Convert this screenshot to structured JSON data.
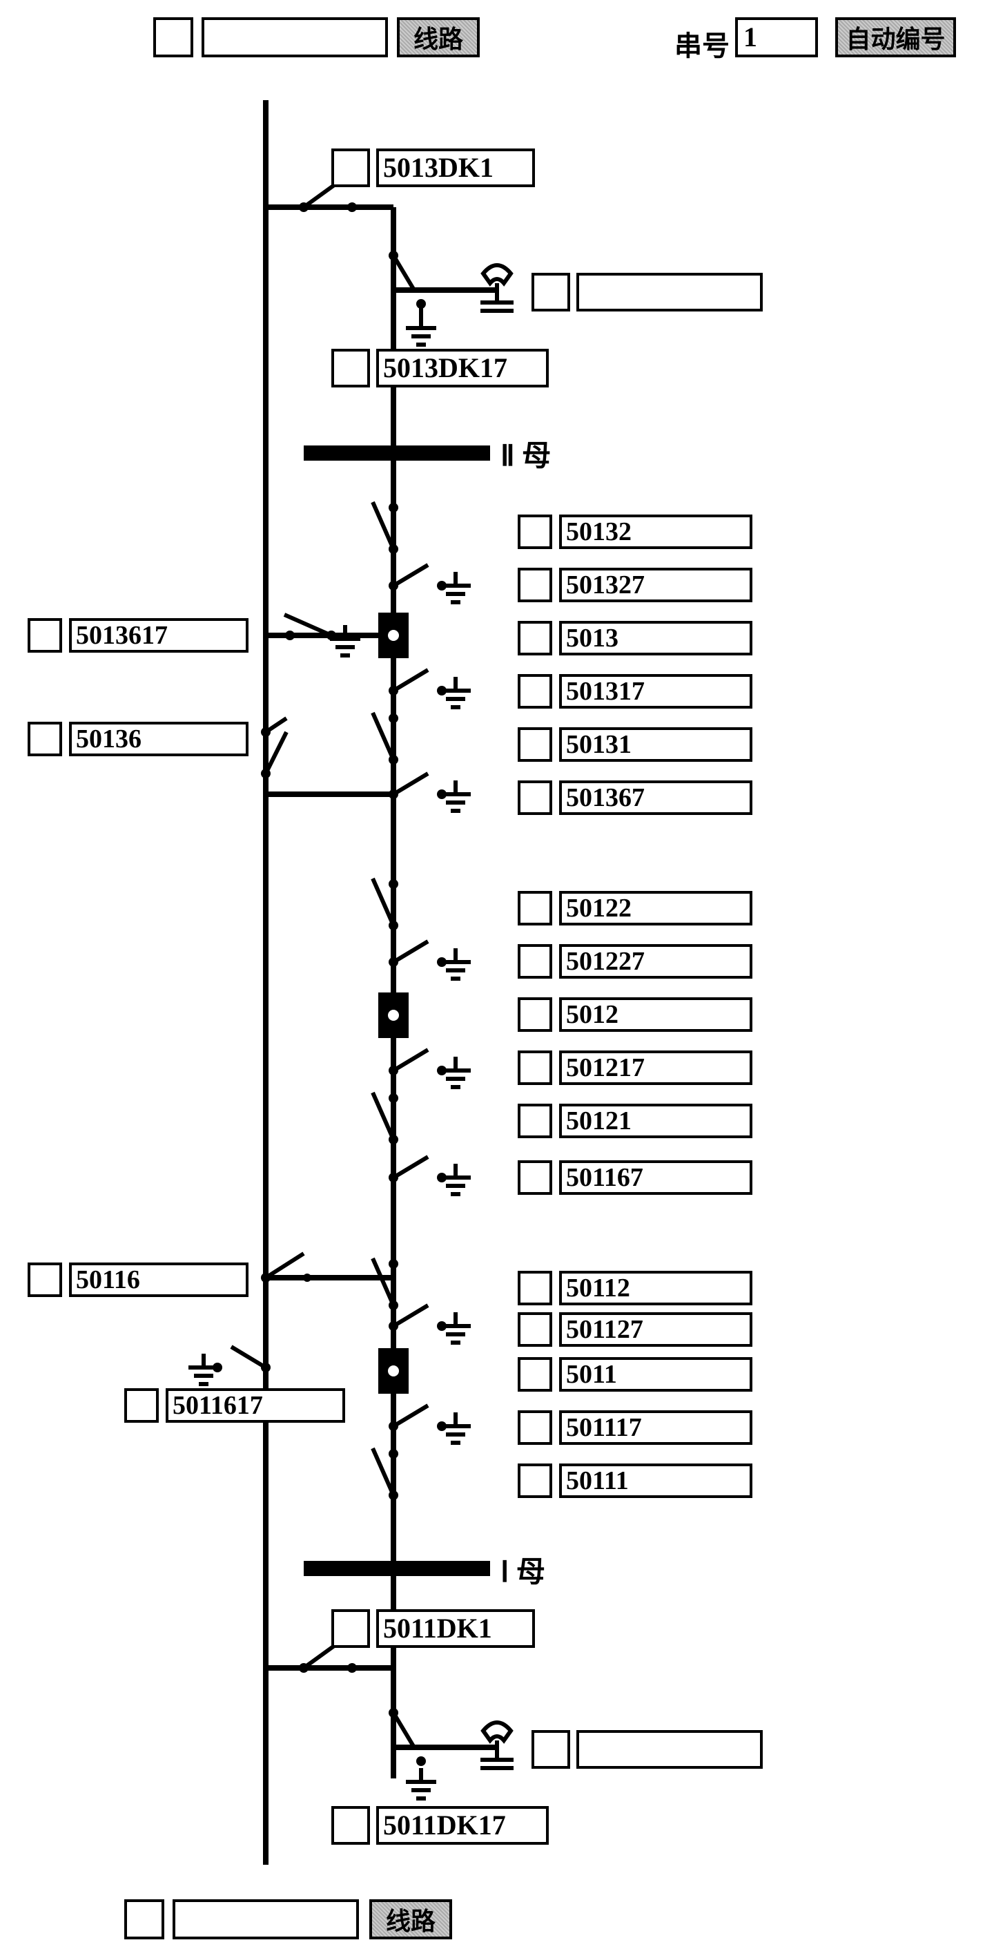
{
  "top": {
    "line_btn": "线路",
    "serial_label": "串号",
    "serial_value": "1",
    "auto_btn": "自动编号"
  },
  "buses": {
    "bus2": "II 母",
    "bus1": "I 母"
  },
  "bottom": {
    "line_btn": "线路"
  },
  "labels": {
    "l5013DK1": "5013DK1",
    "l5013DK17": "5013DK17",
    "l50132": "50132",
    "l501327": "501327",
    "l5013617": "5013617",
    "l5013": "5013",
    "l501317": "501317",
    "l50136": "50136",
    "l50131": "50131",
    "l501367": "501367",
    "l50122": "50122",
    "l501227": "501227",
    "l5012": "5012",
    "l501217": "501217",
    "l50121": "50121",
    "l501167": "501167",
    "l50116": "50116",
    "l50112": "50112",
    "l501127": "501127",
    "l5011617": "5011617",
    "l5011": "5011",
    "l501117": "501117",
    "l50111": "50111",
    "l5011DK1": "5011DK1",
    "l5011DK17": "5011DK17"
  }
}
